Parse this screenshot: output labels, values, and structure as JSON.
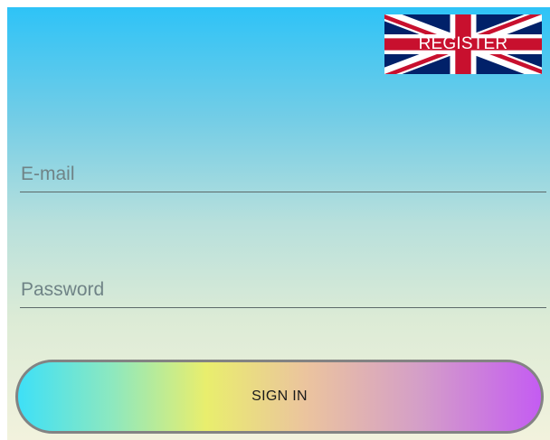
{
  "register_button": {
    "label": "REGISTER",
    "background_icon": "uk-flag-icon"
  },
  "email": {
    "placeholder": "E-mail",
    "value": ""
  },
  "password": {
    "placeholder": "Password",
    "value": ""
  },
  "sign_in_button": {
    "label": "SIGN IN"
  },
  "colors": {
    "background_top": "#2ec3f7",
    "background_bottom": "#f2f2dd",
    "flag_blue": "#012169",
    "flag_red": "#c8102e",
    "button_gradient": [
      "#3ee0f7",
      "#e9ee6d",
      "#d49ec8",
      "#c45cf2"
    ]
  }
}
